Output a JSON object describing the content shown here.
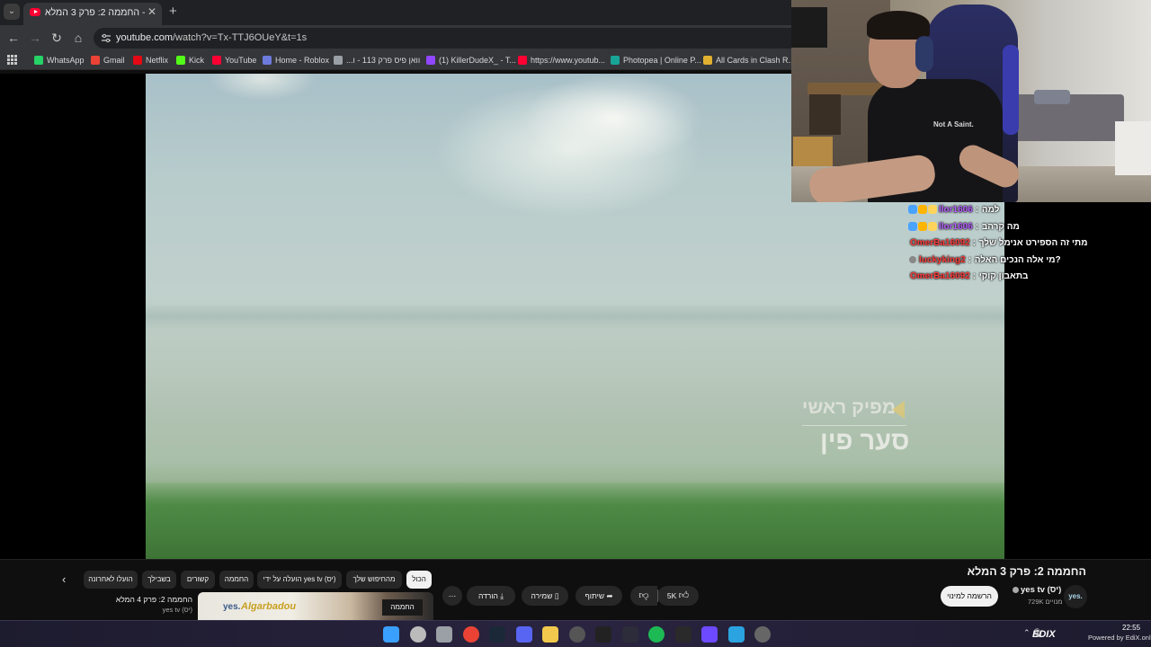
{
  "browser": {
    "tab": {
      "title": "החממה 2: פרק 3 המלא - YouTube"
    },
    "url": {
      "host": "youtube.com",
      "path": "/watch?v=Tx-TTJ6OUeY&t=1s"
    },
    "bookmarks": [
      {
        "label": "WhatsApp",
        "icon": "whatsapp-icon",
        "color": "#25d366"
      },
      {
        "label": "Gmail",
        "icon": "gmail-icon",
        "color": "#ea4335"
      },
      {
        "label": "Netflix",
        "icon": "netflix-icon",
        "color": "#e50914"
      },
      {
        "label": "Kick",
        "icon": "kick-icon",
        "color": "#53fc18"
      },
      {
        "label": "YouTube",
        "icon": "youtube-icon",
        "color": "#ff0033"
      },
      {
        "label": "Home - Roblox",
        "icon": "roblox-icon",
        "color": "#6c7bdb"
      },
      {
        "label": "...וואן פיס פרק 113 - ו",
        "icon": "globe-icon",
        "color": "#9aa0a6"
      },
      {
        "label": "(1) KillerDudeX_ - T...",
        "icon": "twitch-icon",
        "color": "#9146ff"
      },
      {
        "label": "https://www.youtub...",
        "icon": "youtube-icon",
        "color": "#ff0033"
      },
      {
        "label": "Photopea | Online P...",
        "icon": "photopea-icon",
        "color": "#18a497"
      },
      {
        "label": "All Cards in Clash R...",
        "icon": "clash-royale-icon",
        "color": "#e0b030"
      }
    ]
  },
  "video": {
    "credit_role": "מפיק ראשי",
    "credit_name": "סער פין"
  },
  "webcam": {
    "shirt_text": "Not A Saint."
  },
  "chat": [
    {
      "user": "llor1606",
      "message": "למה",
      "user_color": "#b65cff",
      "badges": true
    },
    {
      "user": "llor1606",
      "message": "מה קרהב",
      "user_color": "#b65cff",
      "badges": true
    },
    {
      "user": "OmerBa16092",
      "message": "מתי זה הספירט אנימל שלך",
      "user_color": "#ff3b3b",
      "badges": false
    },
    {
      "user": "luckyking2",
      "message": "?מי אלה הנכים האלה",
      "user_color": "#ff3b3b",
      "badges": "single"
    },
    {
      "user": "OmerBa16092",
      "message": "בתאבון קוקי",
      "user_color": "#ff3b3b",
      "badges": false
    }
  ],
  "watch": {
    "title": "החממה 2: פרק 3 המלא",
    "channel": {
      "name": "yes tv (יס)",
      "subs": "729K מנויים",
      "avatar_text": "yes."
    },
    "subscribe_label": "הרשמה למינוי",
    "likes": "5K",
    "share_label": "שיתוף",
    "save_label": "שמירה",
    "download_label": "הורדה",
    "more_label": "⋯"
  },
  "chips": [
    "הכול",
    "מהחיפוש שלך",
    "הועלה על ידי yes tv (יס)",
    "החממה",
    "קשורים",
    "בשבילך",
    "הועלו לאחרונה"
  ],
  "recommendation": {
    "title": "החממה 2: פרק 4 המלא",
    "channel": "yes tv (יס)",
    "thumb_logo": "yes.",
    "thumb_text": "Algarbadou",
    "thumb_badge": "החממה"
  },
  "taskbar": {
    "icons": [
      "windows-start-icon",
      "search-icon",
      "task-view-icon",
      "chrome-icon",
      "steam-icon",
      "discord-icon",
      "file-explorer-icon",
      "obs-icon",
      "capcut-icon",
      "app-icon",
      "spotify-icon",
      "epic-games-icon",
      "proton-icon",
      "telegram-icon",
      "media-player-icon"
    ],
    "tray_brand": "EDIX",
    "tray_powered": "Powered by EdiX.online",
    "time": "22:55"
  }
}
